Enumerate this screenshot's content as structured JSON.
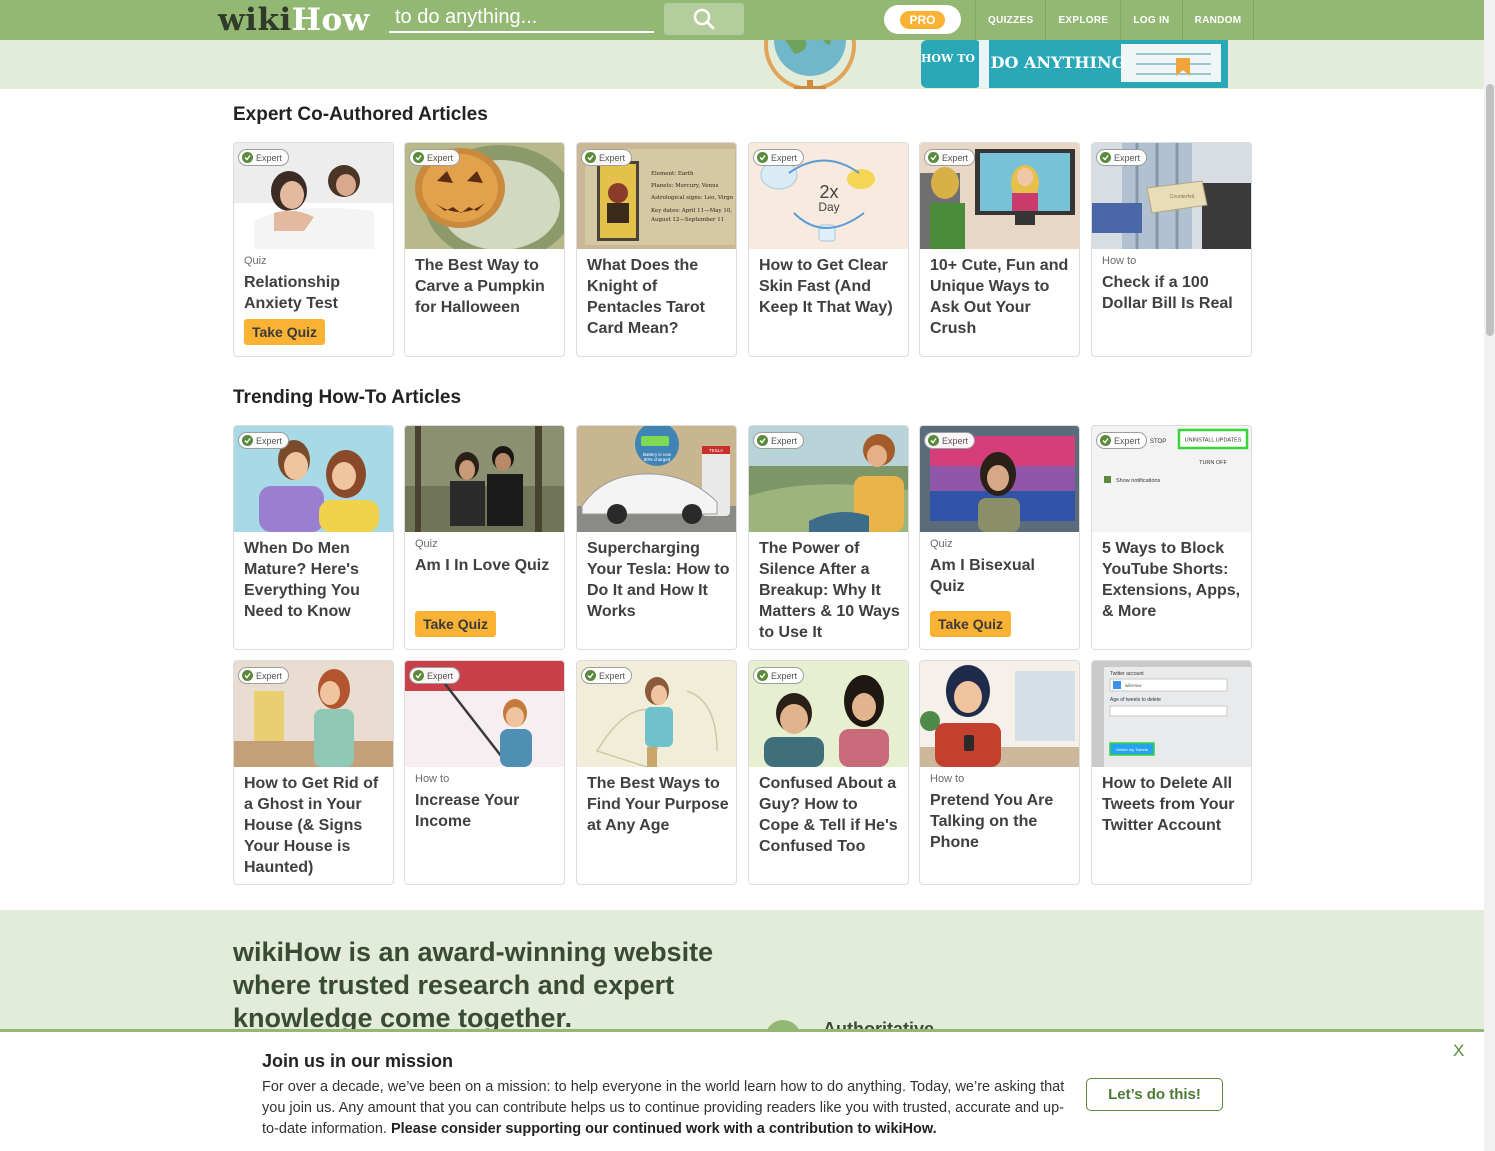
{
  "header": {
    "logo_wiki": "wiki",
    "logo_how": "How",
    "search_placeholder": "to do anything...",
    "search_icon": "search-icon",
    "pro_label": "PRO",
    "nav": [
      "QUIZZES",
      "EXPLORE",
      "LOG IN",
      "RANDOM"
    ]
  },
  "hero": {
    "book_small": "HOW TO",
    "book_text": "DO ANYTHING"
  },
  "sections": {
    "expert_title": "Expert Co-Authored Articles",
    "trending_title": "Trending How-To Articles"
  },
  "badge_label": "Expert",
  "quiz_button_label": "Take Quiz",
  "expert_cards": [
    {
      "kicker": "Quiz",
      "title": "Relationship Anxiety Test"
    },
    {
      "kicker": "",
      "title": "The Best Way to Carve a Pumpkin for Halloween"
    },
    {
      "kicker": "",
      "title": "What Does the Knight of Pentacles Tarot Card Mean?"
    },
    {
      "kicker": "",
      "title": "How to Get Clear Skin Fast (And Keep It That Way)"
    },
    {
      "kicker": "",
      "title": "10+ Cute, Fun and Unique Ways to Ask Out Your Crush"
    },
    {
      "kicker": "How to",
      "title": "Check if a 100 Dollar Bill Is Real"
    }
  ],
  "trending_cards_row1": [
    {
      "kicker": "",
      "title": "When Do Men Mature? Here's Everything You Need to Know"
    },
    {
      "kicker": "Quiz",
      "title": "Am I In Love Quiz"
    },
    {
      "kicker": "",
      "title": "Supercharging Your Tesla: How to Do It and How It Works"
    },
    {
      "kicker": "",
      "title": "The Power of Silence After a Breakup: Why It Matters & 10 Ways to Use It"
    },
    {
      "kicker": "Quiz",
      "title": "Am I Bisexual Quiz"
    },
    {
      "kicker": "",
      "title": "5 Ways to Block YouTube Shorts: Extensions, Apps, & More"
    }
  ],
  "trending_cards_row2": [
    {
      "kicker": "",
      "title": "How to Get Rid of a Ghost in Your House (& Signs Your House is Haunted)"
    },
    {
      "kicker": "How to",
      "title": "Increase Your Income"
    },
    {
      "kicker": "",
      "title": "The Best Ways to Find Your Purpose at Any Age"
    },
    {
      "kicker": "",
      "title": "Confused About a Guy? How to Cope & Tell if He's Confused Too"
    },
    {
      "kicker": "How to",
      "title": "Pretend You Are Talking on the Phone"
    },
    {
      "kicker": "",
      "title": "How to Delete All Tweets from Your Twitter Account"
    }
  ],
  "thumb_text": {
    "tarot_lines": [
      "Element: Earth",
      "Planets: Mercury, Venus",
      "Astrological signs: Leo, Virgo",
      "Key dates: April 11—May 10,",
      "August 12—September 11"
    ],
    "skin_label_big": "2x",
    "skin_label_small": "Day",
    "bill_label": "Counterfeit",
    "tesla_label_1": "Battery is now",
    "tesla_label_2": "80% charged",
    "tesla_brand": "TESLA",
    "yt_stop": "STOP",
    "yt_uninstall": "UNINSTALL UPDATES",
    "yt_turnoff": "TURN OFF",
    "yt_notifications": "Show notifications",
    "tw_account": "Twitter account",
    "tw_handle": "wikiHow",
    "tw_age": "Age of tweets to delete",
    "tw_button": "Delete my Tweets"
  },
  "promo": {
    "headline": "wikiHow is an award-winning website where trusted research and expert knowledge come together.",
    "authoritative": "Authoritative"
  },
  "banner": {
    "title": "Join us in our mission",
    "body": "For over a decade, we’ve been on a mission: to help everyone in the world learn how to do anything. Today, we’re asking that you join us. Any amount that you can contribute helps us to continue providing readers like you with trusted, accurate and up-to-date information.",
    "body_bold": "Please consider supporting our continued work with a contribution to wikiHow.",
    "cta": "Let’s do this!",
    "close": "X"
  },
  "colors": {
    "brand_green": "#93b874",
    "light_green": "#e2ecd8",
    "quiz_yellow": "#f9b233",
    "dark_green": "#5b8a3c"
  }
}
